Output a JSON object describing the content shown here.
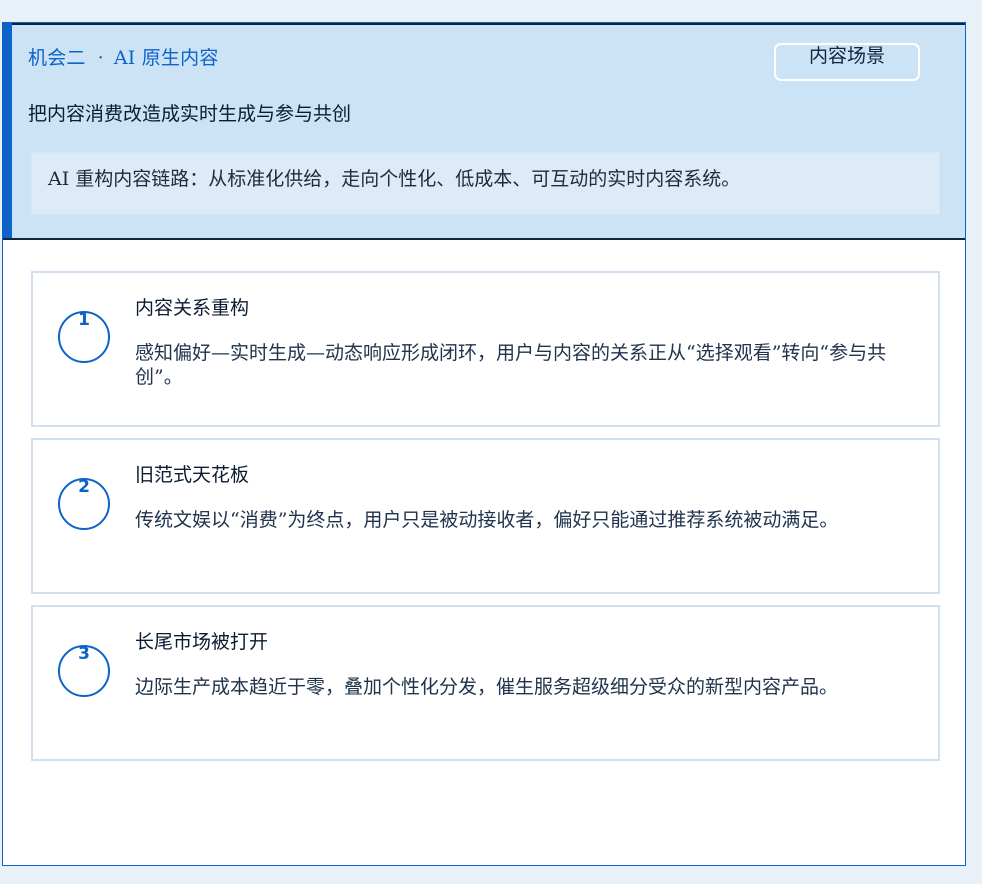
{
  "header": {
    "eyebrow_prefix": "机会二",
    "eyebrow_separator": "·",
    "eyebrow_title": "AI 原生内容",
    "tag": "内容场景",
    "subtitle": "把内容消费改造成实时生成与参与共创",
    "summary": "AI 重构内容链路：从标准化供给，走向个性化、低成本、可互动的实时内容系统。"
  },
  "items": [
    {
      "number": "1",
      "title": "内容关系重构",
      "body": "感知偏好—实时生成—动态响应形成闭环，用户与内容的关系正从“选择观看”转向“参与共创”。"
    },
    {
      "number": "2",
      "title": "旧范式天花板",
      "body": "传统文娱以“消费”为终点，用户只是被动接收者，偏好只能通过推荐系统被动满足。"
    },
    {
      "number": "3",
      "title": "长尾市场被打开",
      "body": "边际生产成本趋近于零，叠加个性化分发，催生服务超级细分受众的新型内容产品。"
    }
  ],
  "colors": {
    "accent": "#0d63c9",
    "hero_background": "#cce3f6",
    "summary_background": "#ddebf8",
    "page_background": "#e8f0f8",
    "divider": "#10233f"
  }
}
